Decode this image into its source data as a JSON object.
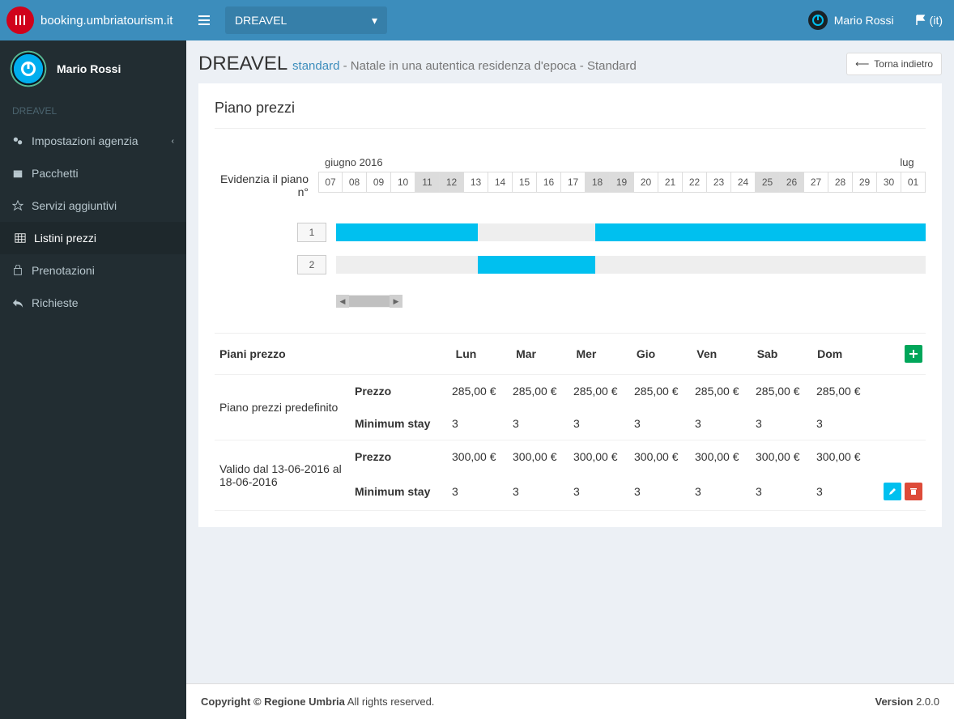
{
  "brand": "booking.umbriatourism.it",
  "topbar": {
    "dropdown": "DREAVEL",
    "user": "Mario Rossi",
    "locale": "(it)"
  },
  "sidebar": {
    "user": "Mario Rossi",
    "section": "DREAVEL",
    "items": [
      {
        "label": "Impostazioni agenzia",
        "hasChildren": true
      },
      {
        "label": "Pacchetti"
      },
      {
        "label": "Servizi aggiuntivi"
      },
      {
        "label": "Listini prezzi",
        "active": true
      },
      {
        "label": "Prenotazioni"
      },
      {
        "label": "Richieste"
      }
    ]
  },
  "header": {
    "title": "DREAVEL",
    "link": "standard",
    "desc": " - Natale in una autentica residenza d'epoca - Standard",
    "back": "Torna indietro"
  },
  "panel": {
    "title": "Piano prezzi"
  },
  "gantt": {
    "label": "Evidenzia il piano n°",
    "month_left": "giugno 2016",
    "month_right": "lug",
    "days": [
      "07",
      "08",
      "09",
      "10",
      "11",
      "12",
      "13",
      "14",
      "15",
      "16",
      "17",
      "18",
      "19",
      "20",
      "21",
      "22",
      "23",
      "24",
      "25",
      "26",
      "27",
      "28",
      "29",
      "30",
      "01"
    ],
    "highlight": [
      "11",
      "12",
      "18",
      "19",
      "25",
      "26"
    ],
    "plans": [
      "1",
      "2"
    ],
    "bars": {
      "row1": [
        {
          "startDay": "07",
          "endDay": "12"
        },
        {
          "startDay": "18",
          "endDay": "01"
        }
      ],
      "row2": [
        {
          "startDay": "13",
          "endDay": "17"
        }
      ]
    }
  },
  "priceTable": {
    "headers": {
      "plan": "Piani prezzo",
      "days": [
        "Lun",
        "Mar",
        "Mer",
        "Gio",
        "Ven",
        "Sab",
        "Dom"
      ]
    },
    "labels": {
      "price": "Prezzo",
      "minstay": "Minimum stay"
    },
    "groups": [
      {
        "name": "Piano prezzi predefinito",
        "price": [
          "285,00 €",
          "285,00 €",
          "285,00 €",
          "285,00 €",
          "285,00 €",
          "285,00 €",
          "285,00 €"
        ],
        "minstay": [
          "3",
          "3",
          "3",
          "3",
          "3",
          "3",
          "3"
        ],
        "actions": "add"
      },
      {
        "name": "Valido dal 13-06-2016 al 18-06-2016",
        "price": [
          "300,00 €",
          "300,00 €",
          "300,00 €",
          "300,00 €",
          "300,00 €",
          "300,00 €",
          "300,00 €"
        ],
        "minstay": [
          "3",
          "3",
          "3",
          "3",
          "3",
          "3",
          "3"
        ],
        "actions": "editdelete"
      }
    ]
  },
  "footer": {
    "copyright_bold": "Copyright © Regione Umbria",
    "copyright_rest": " All rights reserved.",
    "version_label": "Version",
    "version": " 2.0.0"
  }
}
